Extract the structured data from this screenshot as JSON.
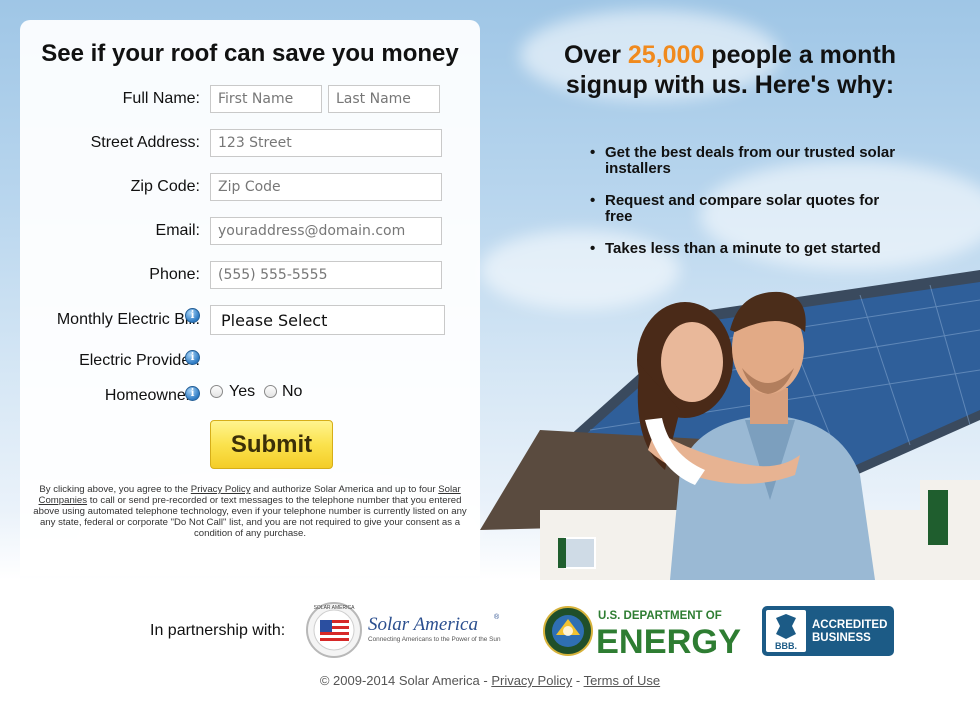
{
  "form": {
    "title": "See if your roof can save you money",
    "full_name_label": "Full Name:",
    "first_name_placeholder": "First Name",
    "last_name_placeholder": "Last Name",
    "street_label": "Street Address:",
    "street_placeholder": "123 Street",
    "zip_label": "Zip Code:",
    "zip_placeholder": "Zip Code",
    "email_label": "Email:",
    "email_placeholder": "youraddress@domain.com",
    "phone_label": "Phone:",
    "phone_placeholder": "(555) 555-5555",
    "bill_label": "Monthly Electric Bill:",
    "bill_selected": "Please Select",
    "provider_label": "Electric Provider:",
    "homeowner_label": "Homeowner?",
    "yes_label": "Yes",
    "no_label": "No",
    "submit_label": "Submit",
    "info_icon": "i",
    "disclaimer_1": "By clicking above, you agree to the ",
    "privacy_link": "Privacy Policy",
    "disclaimer_2": " and authorize Solar America and up to four ",
    "solar_companies_link": "Solar Companies",
    "disclaimer_3": " to call or send pre-recorded or text messages to the telephone number that you entered above using automated telephone technology, even if your telephone number is currently listed on any any state, federal or corporate \"Do Not Call\" list, and you are not required to give your consent as a condition of any purchase."
  },
  "promo": {
    "headline_pre": "Over ",
    "headline_number": "25,000",
    "headline_post": " people a month signup with us. Here's why:",
    "bullet_glyph": "•",
    "bullets": [
      "Get the best deals from our trusted solar installers",
      "Request and compare solar quotes for free",
      "Takes less than a minute to get started"
    ]
  },
  "footer": {
    "partnership_label": "In partnership with:",
    "solar_america_name": "Solar America",
    "solar_america_reg": "®",
    "solar_america_tagline": "Connecting Americans to the Power of the Sun",
    "solar_america_seal_text": "SOLAR AMERICA",
    "doe_line1": "U.S. DEPARTMENT OF",
    "doe_line2": "ENERGY",
    "bbb_short": "BBB.",
    "bbb_line1": "ACCREDITED",
    "bbb_line2": "BUSINESS",
    "copyright": "© 2009-2014 Solar America - ",
    "privacy_link": "Privacy Policy",
    "separator": " - ",
    "terms_link": "Terms of Use"
  },
  "colors": {
    "accent_orange": "#f08a1e",
    "submit_yellow": "#fbe24d",
    "bbb_blue": "#1c5b86",
    "doe_green": "#2e7d32"
  },
  "icons": [
    "info-icon",
    "solar-america-logo",
    "doe-seal-logo",
    "bbb-logo",
    "bullet-icon"
  ]
}
